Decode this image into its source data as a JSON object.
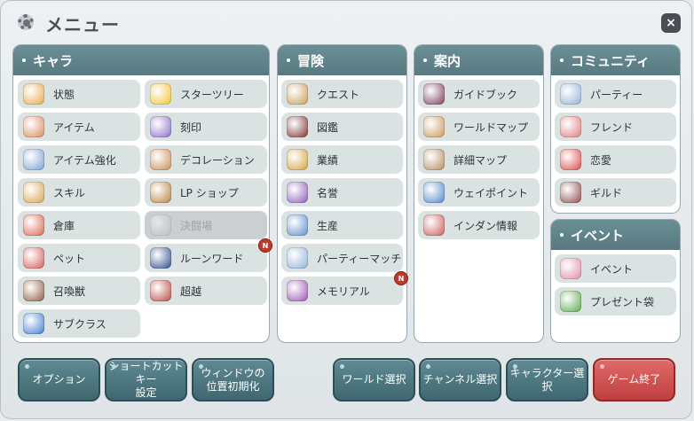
{
  "window": {
    "title": "メニュー",
    "close_label": "×"
  },
  "panels": {
    "chara": {
      "header": "キャラ",
      "items": [
        {
          "label": "状態",
          "icon": "character-face-icon",
          "color": "#e8a84a"
        },
        {
          "label": "スターツリー",
          "icon": "star-icon",
          "color": "#f2c230"
        },
        {
          "label": "アイテム",
          "icon": "item-bag-icon",
          "color": "#d98a5a"
        },
        {
          "label": "刻印",
          "icon": "moon-icon",
          "color": "#8a6bc9"
        },
        {
          "label": "アイテム強化",
          "icon": "enhance-hammer-icon",
          "color": "#7a9fd0"
        },
        {
          "label": "デコレーション",
          "icon": "decoration-icon",
          "color": "#c98a55"
        },
        {
          "label": "スキル",
          "icon": "skill-book-icon",
          "color": "#d4a34c"
        },
        {
          "label": "LP ショップ",
          "icon": "shop-chest-icon",
          "color": "#b3823f"
        },
        {
          "label": "倉庫",
          "icon": "storage-icon",
          "color": "#d9644a"
        },
        {
          "label": "決闘場",
          "icon": "crossed-swords-icon",
          "color": "#a8aeb2",
          "disabled": true
        },
        {
          "label": "ペット",
          "icon": "pet-icon",
          "color": "#d75a5a"
        },
        {
          "label": "ルーンワード",
          "icon": "rune-icon",
          "color": "#2c4a8a",
          "badge": "N"
        },
        {
          "label": "召喚獣",
          "icon": "summon-icon",
          "color": "#8b5a3c"
        },
        {
          "label": "超越",
          "icon": "transcend-shield-icon",
          "color": "#b9473a"
        },
        {
          "label": "サブクラス",
          "icon": "subclass-icon",
          "color": "#3d7ad1"
        }
      ]
    },
    "adventure": {
      "header": "冒険",
      "items": [
        {
          "label": "クエスト",
          "icon": "quest-scroll-icon",
          "color": "#c99a55"
        },
        {
          "label": "図鑑",
          "icon": "encyclopedia-icon",
          "color": "#7a2f2f"
        },
        {
          "label": "業績",
          "icon": "trophy-icon",
          "color": "#d2a23c"
        },
        {
          "label": "名誉",
          "icon": "honor-medal-icon",
          "color": "#8c5ab8"
        },
        {
          "label": "生産",
          "icon": "production-gear-icon",
          "color": "#5d8ac9"
        },
        {
          "label": "パーティーマッチ",
          "icon": "party-match-icon",
          "color": "#8fb0d6"
        },
        {
          "label": "メモリアル",
          "icon": "memorial-icon",
          "color": "#9b4fb0",
          "badge": "N"
        }
      ]
    },
    "guide": {
      "header": "案内",
      "items": [
        {
          "label": "ガイドブック",
          "icon": "guidebook-icon",
          "color": "#7a3b5a"
        },
        {
          "label": "ワールドマップ",
          "icon": "world-map-icon",
          "color": "#c9965a"
        },
        {
          "label": "詳細マップ",
          "icon": "detail-map-icon",
          "color": "#b38b5a"
        },
        {
          "label": "ウェイポイント",
          "icon": "waypoint-orb-icon",
          "color": "#4f86c9"
        },
        {
          "label": "インダン情報",
          "icon": "dungeon-info-icon",
          "color": "#c95a5a"
        }
      ]
    },
    "community": {
      "header": "コミュニティ",
      "items": [
        {
          "label": "パーティー",
          "icon": "party-icon",
          "color": "#8fb0d6"
        },
        {
          "label": "フレンド",
          "icon": "friend-icon",
          "color": "#e07a7a"
        },
        {
          "label": "恋愛",
          "icon": "romance-icon",
          "color": "#d94a4a"
        },
        {
          "label": "ギルド",
          "icon": "guild-icon",
          "color": "#8b4a4a"
        }
      ]
    },
    "event": {
      "header": "イベント",
      "items": [
        {
          "label": "イベント",
          "icon": "event-bouquet-icon",
          "color": "#e08aa8"
        },
        {
          "label": "プレゼント袋",
          "icon": "present-bag-icon",
          "color": "#5aa84a"
        }
      ]
    }
  },
  "buttons": {
    "options": "オプション",
    "shortcut_line1": "ショートカットキー",
    "shortcut_line2": "設定",
    "window_line1": "ウィンドウの",
    "window_line2": "位置初期化",
    "world_select": "ワールド選択",
    "channel_select": "チャンネル選択",
    "character_select": "キャラクター選択",
    "game_exit": "ゲーム終了"
  }
}
